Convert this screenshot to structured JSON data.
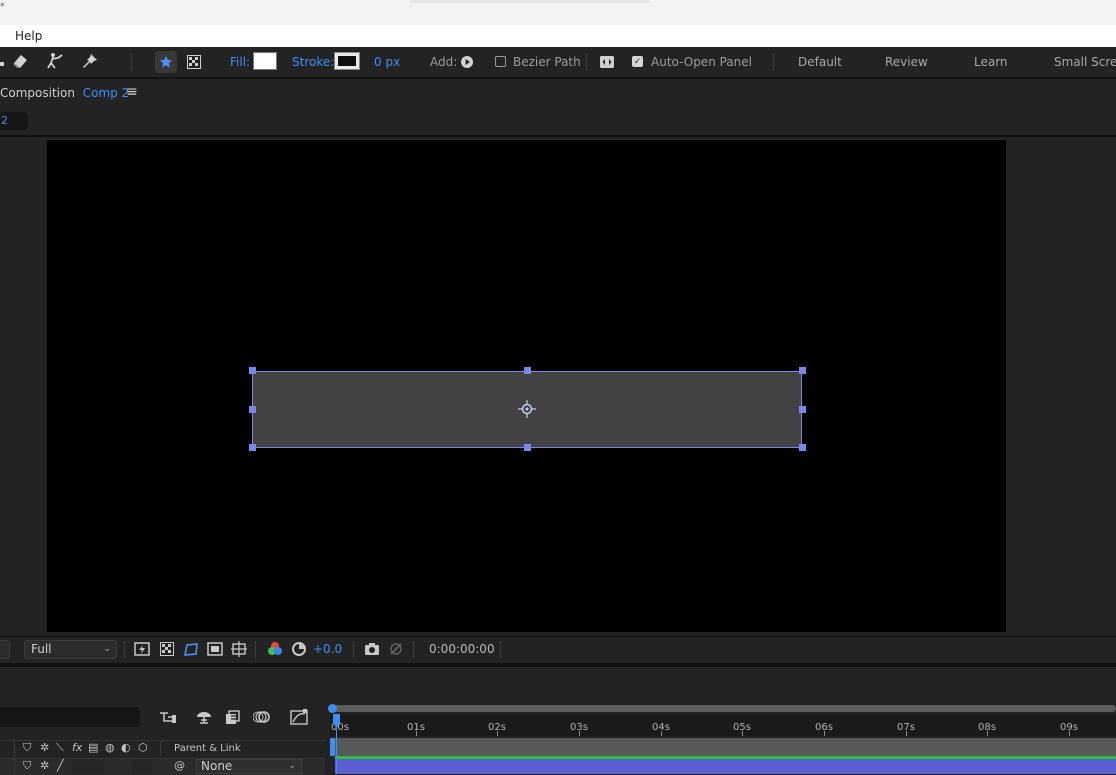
{
  "window": {
    "title": "*"
  },
  "menubar": {
    "items": [
      "Help"
    ]
  },
  "toolbar": {
    "tools": [
      "eraser-icon",
      "puppet-icon",
      "pin-icon",
      "star-icon",
      "checker-icon"
    ],
    "fill_label": "Fill:",
    "stroke_label": "Stroke:",
    "stroke_width": "0 px",
    "add_label": "Add:",
    "bezier_path_label": "Bezier Path",
    "bezier_path_checked": false,
    "auto_open_panel_label": "Auto-Open Panel",
    "auto_open_panel_checked": true,
    "fill_color": "#ffffff",
    "stroke_color": "#101010",
    "workspaces": [
      "Default",
      "Review",
      "Learn",
      "Small Screen"
    ]
  },
  "panel": {
    "tab_prefix": "Composition",
    "comp_name": "Comp 2",
    "comp_chip": "2"
  },
  "viewer": {
    "resolution": "Full",
    "exposure": "+0.0",
    "timecode": "0:00:00:00",
    "shape_fill": "#424242",
    "selection_color": "#7b86e6"
  },
  "timeline": {
    "ticks": [
      "00s",
      "01s",
      "02s",
      "03s",
      "04s",
      "05s",
      "06s",
      "07s",
      "08s",
      "09s"
    ],
    "parent_link_label": "Parent & Link",
    "parent_value": "None",
    "accent": "#3d8ff5",
    "layer_color": "#5a5fd2"
  }
}
